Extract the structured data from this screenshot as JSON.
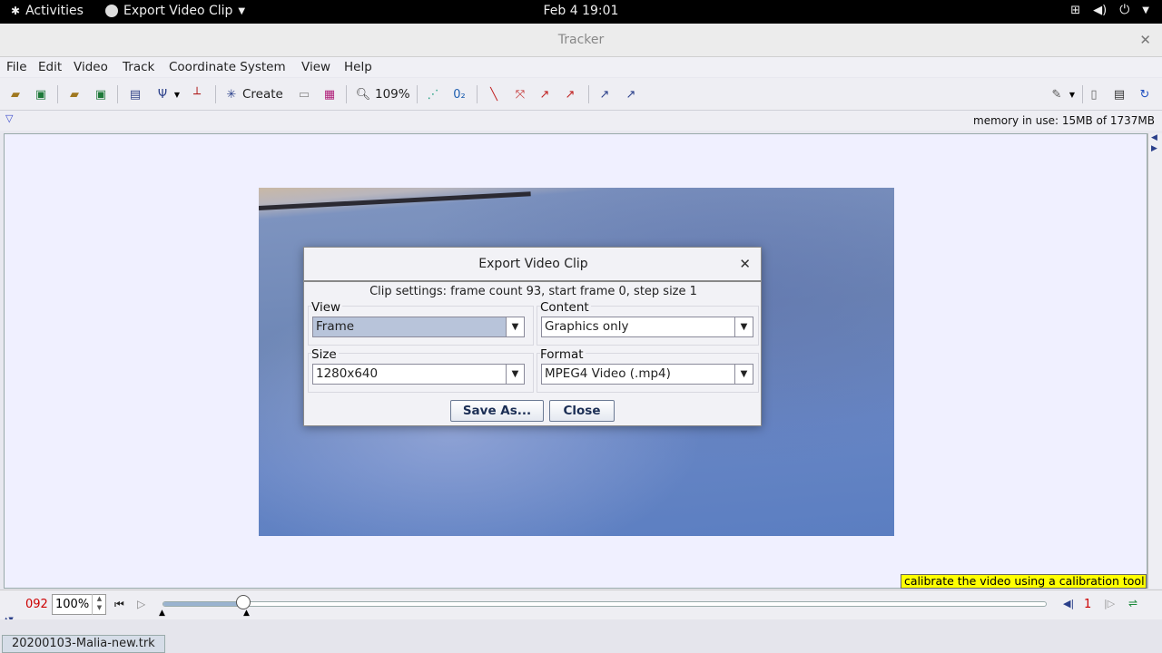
{
  "topbar": {
    "activities": "Activities",
    "app_menu": "Export Video Clip",
    "clock": "Feb 4  19:01"
  },
  "window": {
    "title": "Tracker"
  },
  "menu": {
    "items": [
      "File",
      "Edit",
      "Video",
      "Track",
      "Coordinate System",
      "View",
      "Help"
    ]
  },
  "toolbar": {
    "create_label": "Create",
    "zoom_label": "109%"
  },
  "info": {
    "memory": "memory in use: 15MB of 1737MB"
  },
  "hint": "calibrate the video using a calibration tool",
  "player": {
    "frame_number": "092",
    "zoom_value": "100%",
    "step_size": "1",
    "slider_fraction": 0.092
  },
  "statusbar": {
    "file_tab": "20200103-Malia-new.trk"
  },
  "dialog": {
    "title": "Export Video Clip",
    "settings": "Clip settings: frame count 93, start frame 0, step size 1",
    "view_label": "View",
    "view_value": "Frame",
    "content_label": "Content",
    "content_value": "Graphics only",
    "size_label": "Size",
    "size_value": "1280x640",
    "format_label": "Format",
    "format_value": "MPEG4 Video (.mp4)",
    "save_as": "Save As...",
    "close": "Close"
  }
}
